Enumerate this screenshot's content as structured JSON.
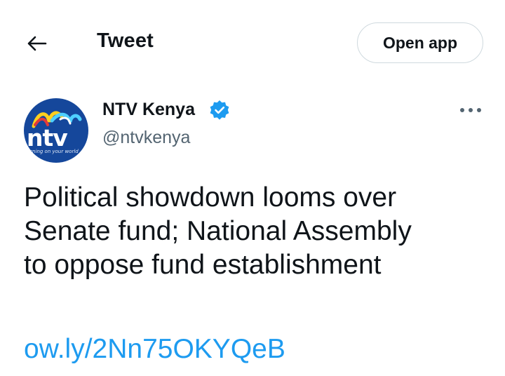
{
  "header": {
    "title": "Tweet",
    "back_icon": "arrow-left-icon",
    "open_app_label": "Open app"
  },
  "author": {
    "display_name": "NTV Kenya",
    "handle": "@ntvkenya",
    "verified": true,
    "verified_icon": "verified-badge-icon",
    "avatar": {
      "logo_text": "ntv",
      "tagline": "turning on your world"
    }
  },
  "more_icon": "more-dots-icon",
  "tweet": {
    "lines": [
      "Political showdown looms over",
      "Senate fund; National Assembly",
      "to oppose fund establishment"
    ],
    "link": "ow.ly/2Nn75OKYQeB"
  },
  "colors": {
    "text": "#0f1419",
    "secondary": "#536471",
    "link": "#1d9bf0",
    "border": "#cfd9de",
    "avatar_bg": "#15479b"
  }
}
